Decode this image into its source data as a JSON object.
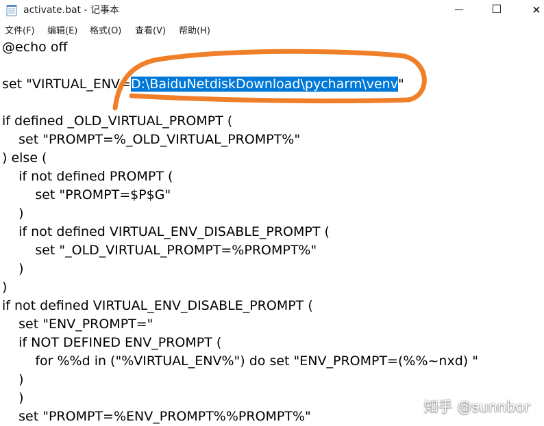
{
  "window": {
    "title": "activate.bat - 记事本",
    "minimize_glyph": "—",
    "maximize_glyph": "☐",
    "close_glyph": "✕"
  },
  "menu": {
    "file": "文件(F)",
    "edit": "编辑(E)",
    "format": "格式(O)",
    "view": "查看(V)",
    "help": "帮助(H)"
  },
  "editor": {
    "lines": [
      "@echo off",
      "",
      "",
      "",
      "if defined _OLD_VIRTUAL_PROMPT (",
      "    set \"PROMPT=%_OLD_VIRTUAL_PROMPT%\"",
      ") else (",
      "    if not defined PROMPT (",
      "        set \"PROMPT=$P$G\"",
      "    )",
      "    if not defined VIRTUAL_ENV_DISABLE_PROMPT (",
      "        set \"_OLD_VIRTUAL_PROMPT=%PROMPT%\"",
      "    )",
      ")",
      "if not defined VIRTUAL_ENV_DISABLE_PROMPT (",
      "    set \"ENV_PROMPT=\"",
      "    if NOT DEFINED ENV_PROMPT (",
      "        for %%d in (\"%VIRTUAL_ENV%\") do set \"ENV_PROMPT=(%%~nxd) \"",
      "    )",
      "    )",
      "    set \"PROMPT=%ENV_PROMPT%%PROMPT%\""
    ],
    "set_line": {
      "prefix": "set \"VIRTUAL_ENV=",
      "selected": "D:\\BaiduNetdiskDownload\\pycharm\\venv",
      "suffix": "\""
    },
    "selection_color": "#0078d7",
    "annotation_color": "#f07f2a"
  },
  "watermark": "知乎 @sunnbor"
}
